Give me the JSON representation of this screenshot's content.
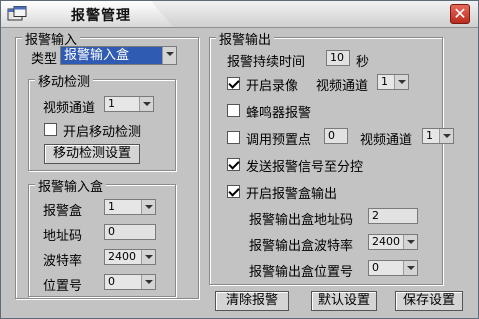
{
  "window": {
    "title": "报警管理"
  },
  "alarm_input": {
    "legend": "报警输入",
    "type_label": "类型",
    "type_value": "报警输入盒",
    "motion": {
      "legend": "移动检测",
      "channel_label": "视频通道",
      "channel_value": "1",
      "enable_label": "开启移动检测",
      "enable_checked": false,
      "settings_button": "移动检测设置"
    },
    "box": {
      "legend": "报警输入盒",
      "box_label": "报警盒",
      "box_value": "1",
      "address_label": "地址码",
      "address_value": "0",
      "baud_label": "波特率",
      "baud_value": "2400",
      "position_label": "位置号",
      "position_value": "0"
    }
  },
  "alarm_output": {
    "legend": "报警输出",
    "duration_label": "报警持续时间",
    "duration_value": "10",
    "duration_unit": "秒",
    "record_label": "开启录像",
    "record_checked": true,
    "record_channel_label": "视频通道",
    "record_channel_value": "1",
    "buzzer_label": "蜂鸣器报警",
    "buzzer_checked": false,
    "preset_label": "调用预置点",
    "preset_checked": false,
    "preset_value": "0",
    "preset_channel_label": "视频通道",
    "preset_channel_value": "1",
    "send_label": "发送报警信号至分控",
    "send_checked": true,
    "box_output_label": "开启报警盒输出",
    "box_output_checked": true,
    "out_address_label": "报警输出盒地址码",
    "out_address_value": "2",
    "out_baud_label": "报警输出盒波特率",
    "out_baud_value": "2400",
    "out_position_label": "报警输出盒位置号",
    "out_position_value": "0"
  },
  "buttons": {
    "clear": "清除报警",
    "default": "默认设置",
    "save": "保存设置"
  },
  "icons": {
    "app": "app-window-icon",
    "close": "close-icon"
  },
  "colors": {
    "window_bg": "#c3c3c3",
    "selected_bg": "#2f5bb3",
    "close_red": "#c8372a"
  }
}
